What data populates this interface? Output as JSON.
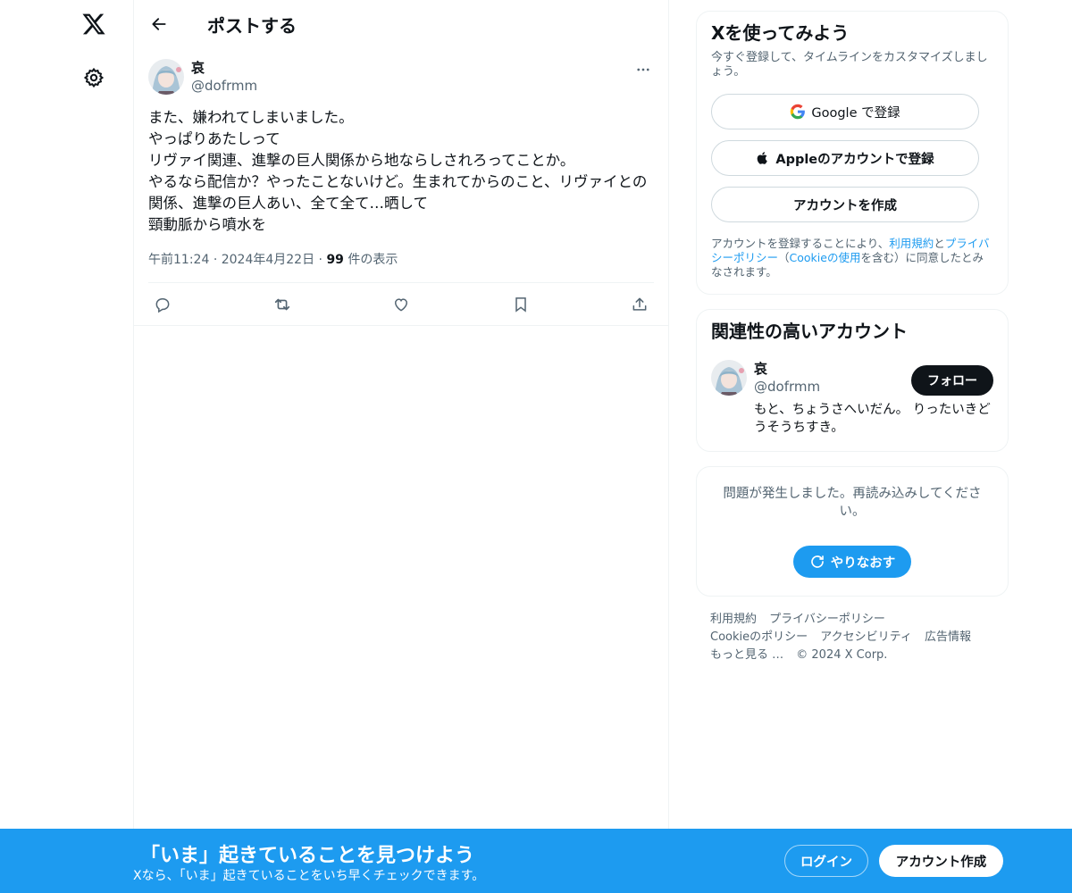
{
  "nav": {
    "logo": "x-logo-icon",
    "settings": "gear-icon"
  },
  "header": {
    "title": "ポストする"
  },
  "post": {
    "author_name": "哀",
    "author_handle": "@dofrmm",
    "body": "また、嫌われてしまいました。\nやっぱりあたしって\nリヴァイ関連、進撃の巨人関係から地ならしされろってことか。\nやるなら配信か？やったことないけど。生まれてからのこと、リヴァイとの関係、進撃の巨人あい、全て全て…晒して\n頸動脈から噴水を",
    "time": "午前11:24",
    "date": "2024年4月22日",
    "views_count": "99",
    "views_label": "件の表示"
  },
  "signup": {
    "title": "Xを使ってみよう",
    "subtitle": "今すぐ登録して、タイムラインをカスタマイズしましょう。",
    "google_label": "Google で登録",
    "apple_label": "Appleのアカウントで登録",
    "create_label": "アカウントを作成",
    "legal_pre": "アカウントを登録することにより、",
    "legal_terms": "利用規約",
    "legal_and": "と",
    "legal_privacy": "プライバシーポリシー",
    "legal_paren_open": "（",
    "legal_cookie": "Cookieの使用",
    "legal_post": "を含む）に同意したとみなされます。"
  },
  "related": {
    "title": "関連性の高いアカウント",
    "name": "哀",
    "handle": "@dofrmm",
    "follow_label": "フォロー",
    "bio": "もと、ちょうさへいだん。 りったいきどうそうちすき。"
  },
  "error": {
    "message": "問題が発生しました。再読み込みしてください。",
    "retry_label": "やりなおす"
  },
  "footer": {
    "links": [
      "利用規約",
      "プライバシーポリシー",
      "Cookieのポリシー",
      "アクセシビリティ",
      "広告情報",
      "もっと見る …",
      "© 2024 X Corp."
    ]
  },
  "bottombar": {
    "title": "「いま」起きていることを見つけよう",
    "subtitle": "Xなら、「いま」起きていることをいち早くチェックできます。",
    "login_label": "ログイン",
    "create_label": "アカウント作成"
  },
  "colors": {
    "accent": "#1d9bf0",
    "text": "#0f1419",
    "muted": "#536471",
    "border": "#eff3f4"
  }
}
